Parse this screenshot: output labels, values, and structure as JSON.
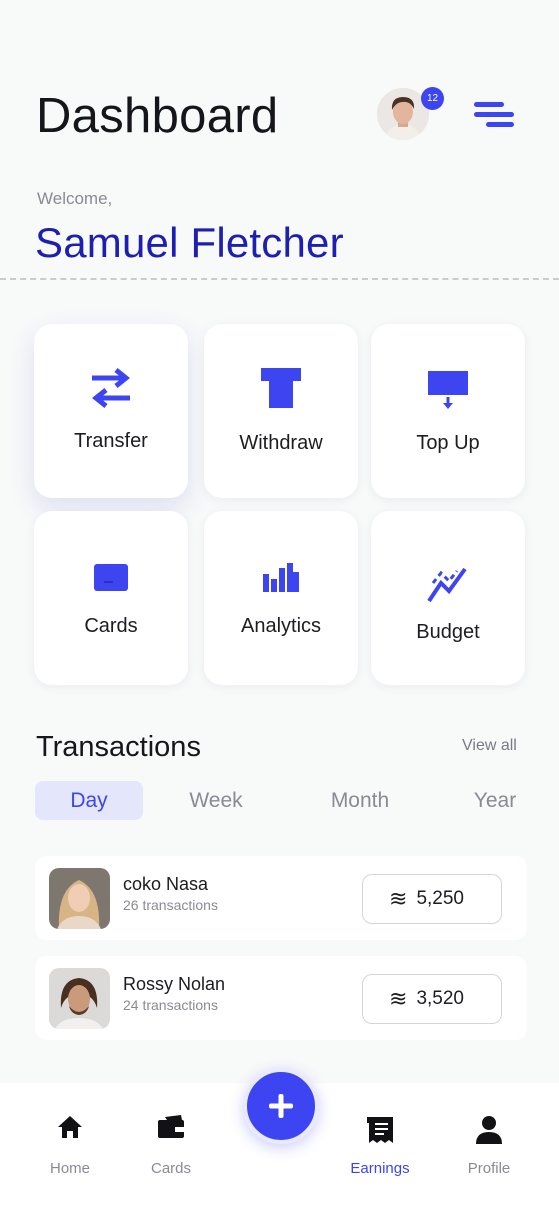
{
  "header": {
    "title": "Dashboard",
    "notification_count": "12",
    "menu_icon": "menu-icon"
  },
  "welcome": {
    "greeting": "Welcome,",
    "user_name": "Samuel Fletcher"
  },
  "actions": [
    {
      "label": "Transfer",
      "icon": "transfer-icon"
    },
    {
      "label": "Withdraw",
      "icon": "withdraw-icon"
    },
    {
      "label": "Top Up",
      "icon": "top-up-icon"
    },
    {
      "label": "Cards",
      "icon": "card-icon"
    },
    {
      "label": "Analytics",
      "icon": "analytics-icon"
    },
    {
      "label": "Budget",
      "icon": "budget-icon"
    }
  ],
  "transactions": {
    "title": "Transactions",
    "view_all": "View all",
    "tabs": [
      "Day",
      "Week",
      "Month",
      "Year"
    ],
    "selected_tab": "Day",
    "items": [
      {
        "name": "coko Nasa",
        "count": "26 transactions",
        "symbol": "≋",
        "amount": "5,250"
      },
      {
        "name": "Rossy Nolan",
        "count": "24 transactions",
        "symbol": "≋",
        "amount": "3,520"
      }
    ]
  },
  "bottom_nav": {
    "items": [
      {
        "label": "Home",
        "icon": "home-icon"
      },
      {
        "label": "Cards",
        "icon": "wallet-icon"
      },
      {
        "label": "Earnings",
        "icon": "receipt-icon"
      },
      {
        "label": "Profile",
        "icon": "person-icon"
      }
    ],
    "active": "Earnings",
    "fab_icon": "plus-icon"
  },
  "colors": {
    "accent": "#3c45f0",
    "name": "#1d1fb0",
    "background": "#f8f9f9"
  }
}
